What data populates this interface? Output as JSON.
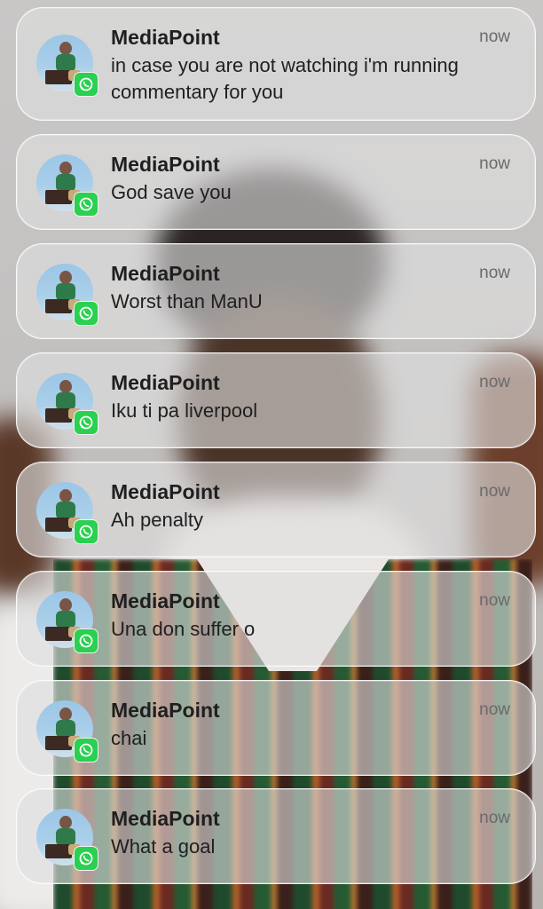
{
  "notifications": [
    {
      "sender": "MediaPoint",
      "time": "now",
      "message": "in case you are not watching i'm running commentary for you",
      "app_icon": "whatsapp-icon"
    },
    {
      "sender": "MediaPoint",
      "time": "now",
      "message": "God save you",
      "app_icon": "whatsapp-icon"
    },
    {
      "sender": "MediaPoint",
      "time": "now",
      "message": "Worst than ManU",
      "app_icon": "whatsapp-icon"
    },
    {
      "sender": "MediaPoint",
      "time": "now",
      "message": "Iku ti pa liverpool",
      "app_icon": "whatsapp-icon"
    },
    {
      "sender": "MediaPoint",
      "time": "now",
      "message": "Ah penalty",
      "app_icon": "whatsapp-icon"
    },
    {
      "sender": "MediaPoint",
      "time": "now",
      "message": "Una don suffer o",
      "app_icon": "whatsapp-icon"
    },
    {
      "sender": "MediaPoint",
      "time": "now",
      "message": "chai",
      "app_icon": "whatsapp-icon"
    },
    {
      "sender": "MediaPoint",
      "time": "now",
      "message": "What a goal",
      "app_icon": "whatsapp-icon"
    }
  ],
  "colors": {
    "whatsapp_green": "#2ad04f",
    "card_background": "rgba(222,222,222,0.62)"
  }
}
